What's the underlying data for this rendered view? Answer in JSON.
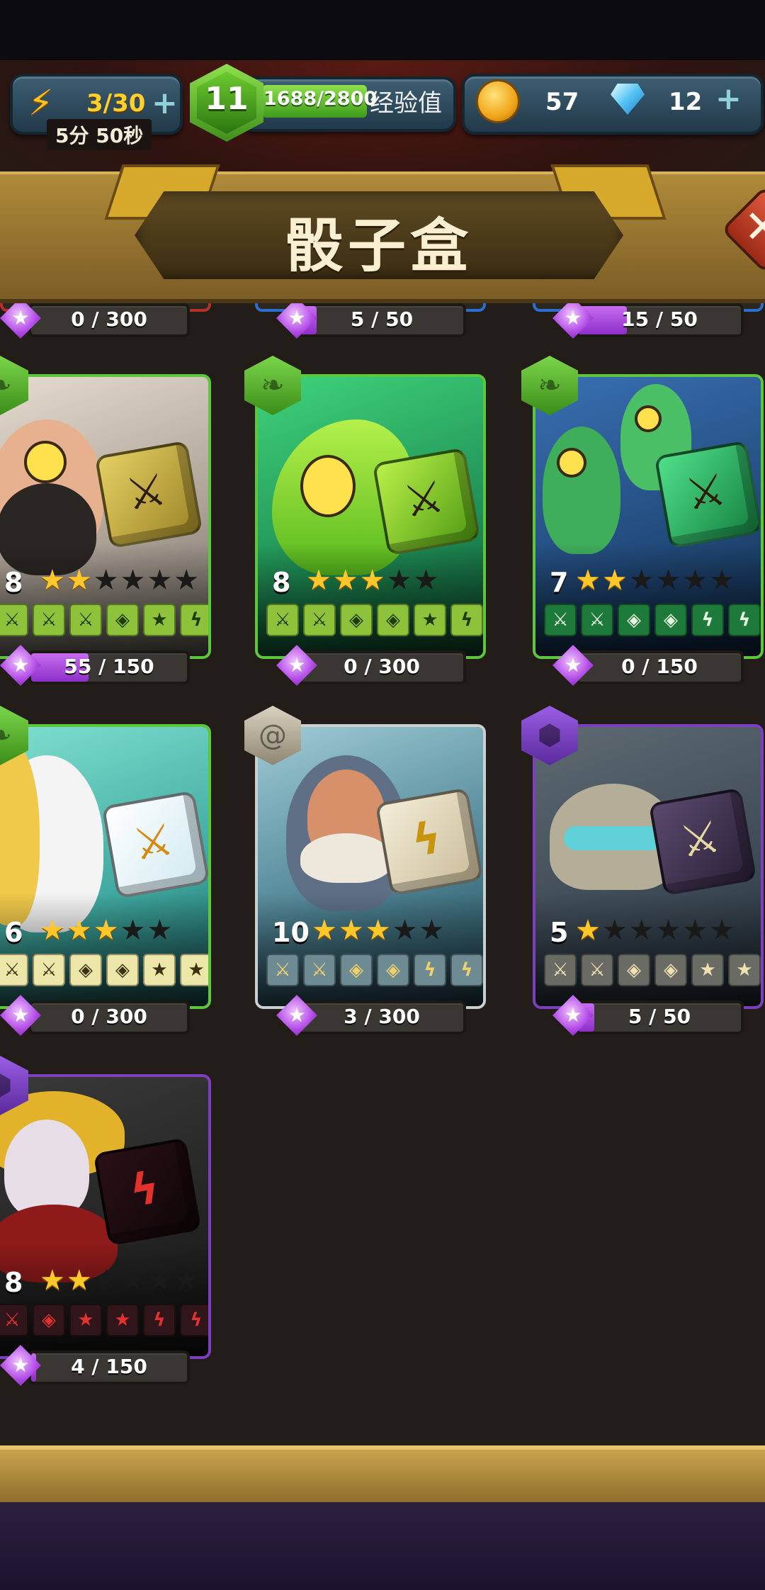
{
  "hud": {
    "energy": "3/30",
    "energy_timer": "5分 50秒",
    "level": "11",
    "xp": "1688/2800",
    "xp_progress": 0.6,
    "xp_label": "经验值",
    "coins": "57",
    "gems": "12"
  },
  "header": {
    "title": "骰子盒"
  },
  "top_row_progress": [
    "0 / 300",
    "5 / 50",
    "15 / 50"
  ],
  "top_row_fill": [
    0.0,
    0.1,
    0.3
  ],
  "cards": [
    {
      "level": "8",
      "stars": 2,
      "type": "green",
      "progress": "55 / 150",
      "fill": 0.37
    },
    {
      "level": "8",
      "stars": 3,
      "type": "green",
      "progress": "0 / 300",
      "fill": 0.0
    },
    {
      "level": "7",
      "stars": 2,
      "type": "green",
      "progress": "0 / 150",
      "fill": 0.0
    },
    {
      "level": "6",
      "stars": 3,
      "type": "green",
      "progress": "0 / 300",
      "fill": 0.0
    },
    {
      "level": "10",
      "stars": 3,
      "type": "gray",
      "progress": "3 / 300",
      "fill": 0.01
    },
    {
      "level": "5",
      "stars": 1,
      "type": "purple",
      "progress": "5 / 50",
      "fill": 0.1
    },
    {
      "level": "8",
      "stars": 2,
      "type": "purple",
      "progress": "4 / 150",
      "fill": 0.03
    }
  ],
  "icons": {
    "energy": "lightning-icon",
    "coin": "coin-icon",
    "gem": "diamond-icon",
    "close": "close-icon",
    "fragment": "purple-gem-icon"
  },
  "colors": {
    "green_border": "#5cc73a",
    "purple_border": "#7d3fbf",
    "gray_border": "#c9d0d2",
    "progress_fill": "#b149e6"
  }
}
